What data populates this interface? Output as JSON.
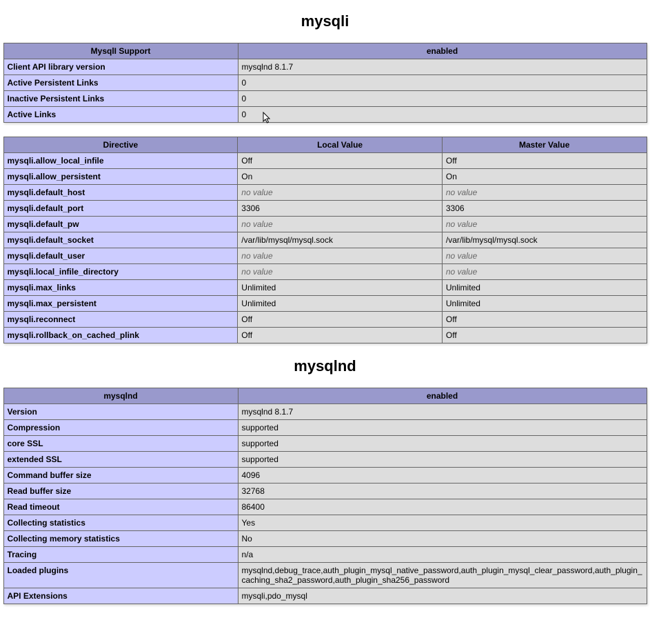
{
  "novalue_text": "no value",
  "sections": [
    {
      "title": "mysqli",
      "tables": [
        {
          "headers": [
            "MysqlI Support",
            "enabled"
          ],
          "col_widths": [
            "340px",
            "auto"
          ],
          "rows": [
            [
              "Client API library version",
              "mysqlnd 8.1.7"
            ],
            [
              "Active Persistent Links",
              "0"
            ],
            [
              "Inactive Persistent Links",
              "0"
            ],
            [
              "Active Links",
              "0"
            ]
          ]
        },
        {
          "headers": [
            "Directive",
            "Local Value",
            "Master Value"
          ],
          "col_widths": [
            "340px",
            "297px",
            "297px"
          ],
          "rows": [
            [
              "mysqli.allow_local_infile",
              "Off",
              "Off"
            ],
            [
              "mysqli.allow_persistent",
              "On",
              "On"
            ],
            [
              "mysqli.default_host",
              null,
              null
            ],
            [
              "mysqli.default_port",
              "3306",
              "3306"
            ],
            [
              "mysqli.default_pw",
              null,
              null
            ],
            [
              "mysqli.default_socket",
              "/var/lib/mysql/mysql.sock",
              "/var/lib/mysql/mysql.sock"
            ],
            [
              "mysqli.default_user",
              null,
              null
            ],
            [
              "mysqli.local_infile_directory",
              null,
              null
            ],
            [
              "mysqli.max_links",
              "Unlimited",
              "Unlimited"
            ],
            [
              "mysqli.max_persistent",
              "Unlimited",
              "Unlimited"
            ],
            [
              "mysqli.reconnect",
              "Off",
              "Off"
            ],
            [
              "mysqli.rollback_on_cached_plink",
              "Off",
              "Off"
            ]
          ]
        }
      ]
    },
    {
      "title": "mysqlnd",
      "tables": [
        {
          "headers": [
            "mysqlnd",
            "enabled"
          ],
          "col_widths": [
            "340px",
            "auto"
          ],
          "rows": [
            [
              "Version",
              "mysqlnd 8.1.7"
            ],
            [
              "Compression",
              "supported"
            ],
            [
              "core SSL",
              "supported"
            ],
            [
              "extended SSL",
              "supported"
            ],
            [
              "Command buffer size",
              "4096"
            ],
            [
              "Read buffer size",
              "32768"
            ],
            [
              "Read timeout",
              "86400"
            ],
            [
              "Collecting statistics",
              "Yes"
            ],
            [
              "Collecting memory statistics",
              "No"
            ],
            [
              "Tracing",
              "n/a"
            ],
            [
              "Loaded plugins",
              "mysqlnd,debug_trace,auth_plugin_mysql_native_password,auth_plugin_mysql_clear_password,auth_plugin_caching_sha2_password,auth_plugin_sha256_password"
            ],
            [
              "API Extensions",
              "mysqli,pdo_mysql"
            ]
          ]
        }
      ]
    }
  ]
}
